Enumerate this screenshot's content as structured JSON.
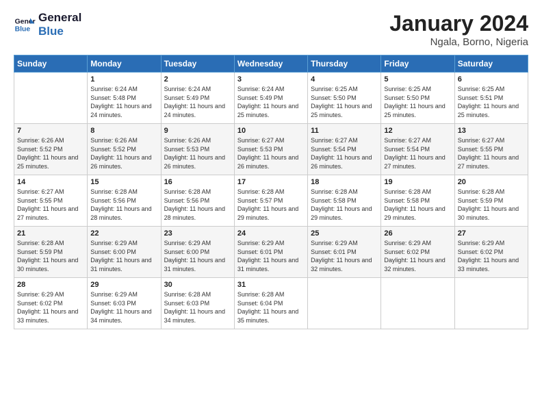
{
  "logo": {
    "line1": "General",
    "line2": "Blue"
  },
  "title": "January 2024",
  "subtitle": "Ngala, Borno, Nigeria",
  "header": {
    "colors": {
      "accent": "#2a6db5"
    }
  },
  "weekdays": [
    "Sunday",
    "Monday",
    "Tuesday",
    "Wednesday",
    "Thursday",
    "Friday",
    "Saturday"
  ],
  "weeks": [
    [
      {
        "day": "",
        "sunrise": "",
        "sunset": "",
        "daylight": ""
      },
      {
        "day": "1",
        "sunrise": "Sunrise: 6:24 AM",
        "sunset": "Sunset: 5:48 PM",
        "daylight": "Daylight: 11 hours and 24 minutes."
      },
      {
        "day": "2",
        "sunrise": "Sunrise: 6:24 AM",
        "sunset": "Sunset: 5:49 PM",
        "daylight": "Daylight: 11 hours and 24 minutes."
      },
      {
        "day": "3",
        "sunrise": "Sunrise: 6:24 AM",
        "sunset": "Sunset: 5:49 PM",
        "daylight": "Daylight: 11 hours and 25 minutes."
      },
      {
        "day": "4",
        "sunrise": "Sunrise: 6:25 AM",
        "sunset": "Sunset: 5:50 PM",
        "daylight": "Daylight: 11 hours and 25 minutes."
      },
      {
        "day": "5",
        "sunrise": "Sunrise: 6:25 AM",
        "sunset": "Sunset: 5:50 PM",
        "daylight": "Daylight: 11 hours and 25 minutes."
      },
      {
        "day": "6",
        "sunrise": "Sunrise: 6:25 AM",
        "sunset": "Sunset: 5:51 PM",
        "daylight": "Daylight: 11 hours and 25 minutes."
      }
    ],
    [
      {
        "day": "7",
        "sunrise": "Sunrise: 6:26 AM",
        "sunset": "Sunset: 5:52 PM",
        "daylight": "Daylight: 11 hours and 25 minutes."
      },
      {
        "day": "8",
        "sunrise": "Sunrise: 6:26 AM",
        "sunset": "Sunset: 5:52 PM",
        "daylight": "Daylight: 11 hours and 26 minutes."
      },
      {
        "day": "9",
        "sunrise": "Sunrise: 6:26 AM",
        "sunset": "Sunset: 5:53 PM",
        "daylight": "Daylight: 11 hours and 26 minutes."
      },
      {
        "day": "10",
        "sunrise": "Sunrise: 6:27 AM",
        "sunset": "Sunset: 5:53 PM",
        "daylight": "Daylight: 11 hours and 26 minutes."
      },
      {
        "day": "11",
        "sunrise": "Sunrise: 6:27 AM",
        "sunset": "Sunset: 5:54 PM",
        "daylight": "Daylight: 11 hours and 26 minutes."
      },
      {
        "day": "12",
        "sunrise": "Sunrise: 6:27 AM",
        "sunset": "Sunset: 5:54 PM",
        "daylight": "Daylight: 11 hours and 27 minutes."
      },
      {
        "day": "13",
        "sunrise": "Sunrise: 6:27 AM",
        "sunset": "Sunset: 5:55 PM",
        "daylight": "Daylight: 11 hours and 27 minutes."
      }
    ],
    [
      {
        "day": "14",
        "sunrise": "Sunrise: 6:27 AM",
        "sunset": "Sunset: 5:55 PM",
        "daylight": "Daylight: 11 hours and 27 minutes."
      },
      {
        "day": "15",
        "sunrise": "Sunrise: 6:28 AM",
        "sunset": "Sunset: 5:56 PM",
        "daylight": "Daylight: 11 hours and 28 minutes."
      },
      {
        "day": "16",
        "sunrise": "Sunrise: 6:28 AM",
        "sunset": "Sunset: 5:56 PM",
        "daylight": "Daylight: 11 hours and 28 minutes."
      },
      {
        "day": "17",
        "sunrise": "Sunrise: 6:28 AM",
        "sunset": "Sunset: 5:57 PM",
        "daylight": "Daylight: 11 hours and 29 minutes."
      },
      {
        "day": "18",
        "sunrise": "Sunrise: 6:28 AM",
        "sunset": "Sunset: 5:58 PM",
        "daylight": "Daylight: 11 hours and 29 minutes."
      },
      {
        "day": "19",
        "sunrise": "Sunrise: 6:28 AM",
        "sunset": "Sunset: 5:58 PM",
        "daylight": "Daylight: 11 hours and 29 minutes."
      },
      {
        "day": "20",
        "sunrise": "Sunrise: 6:28 AM",
        "sunset": "Sunset: 5:59 PM",
        "daylight": "Daylight: 11 hours and 30 minutes."
      }
    ],
    [
      {
        "day": "21",
        "sunrise": "Sunrise: 6:28 AM",
        "sunset": "Sunset: 5:59 PM",
        "daylight": "Daylight: 11 hours and 30 minutes."
      },
      {
        "day": "22",
        "sunrise": "Sunrise: 6:29 AM",
        "sunset": "Sunset: 6:00 PM",
        "daylight": "Daylight: 11 hours and 31 minutes."
      },
      {
        "day": "23",
        "sunrise": "Sunrise: 6:29 AM",
        "sunset": "Sunset: 6:00 PM",
        "daylight": "Daylight: 11 hours and 31 minutes."
      },
      {
        "day": "24",
        "sunrise": "Sunrise: 6:29 AM",
        "sunset": "Sunset: 6:01 PM",
        "daylight": "Daylight: 11 hours and 31 minutes."
      },
      {
        "day": "25",
        "sunrise": "Sunrise: 6:29 AM",
        "sunset": "Sunset: 6:01 PM",
        "daylight": "Daylight: 11 hours and 32 minutes."
      },
      {
        "day": "26",
        "sunrise": "Sunrise: 6:29 AM",
        "sunset": "Sunset: 6:02 PM",
        "daylight": "Daylight: 11 hours and 32 minutes."
      },
      {
        "day": "27",
        "sunrise": "Sunrise: 6:29 AM",
        "sunset": "Sunset: 6:02 PM",
        "daylight": "Daylight: 11 hours and 33 minutes."
      }
    ],
    [
      {
        "day": "28",
        "sunrise": "Sunrise: 6:29 AM",
        "sunset": "Sunset: 6:02 PM",
        "daylight": "Daylight: 11 hours and 33 minutes."
      },
      {
        "day": "29",
        "sunrise": "Sunrise: 6:29 AM",
        "sunset": "Sunset: 6:03 PM",
        "daylight": "Daylight: 11 hours and 34 minutes."
      },
      {
        "day": "30",
        "sunrise": "Sunrise: 6:28 AM",
        "sunset": "Sunset: 6:03 PM",
        "daylight": "Daylight: 11 hours and 34 minutes."
      },
      {
        "day": "31",
        "sunrise": "Sunrise: 6:28 AM",
        "sunset": "Sunset: 6:04 PM",
        "daylight": "Daylight: 11 hours and 35 minutes."
      },
      {
        "day": "",
        "sunrise": "",
        "sunset": "",
        "daylight": ""
      },
      {
        "day": "",
        "sunrise": "",
        "sunset": "",
        "daylight": ""
      },
      {
        "day": "",
        "sunrise": "",
        "sunset": "",
        "daylight": ""
      }
    ]
  ]
}
